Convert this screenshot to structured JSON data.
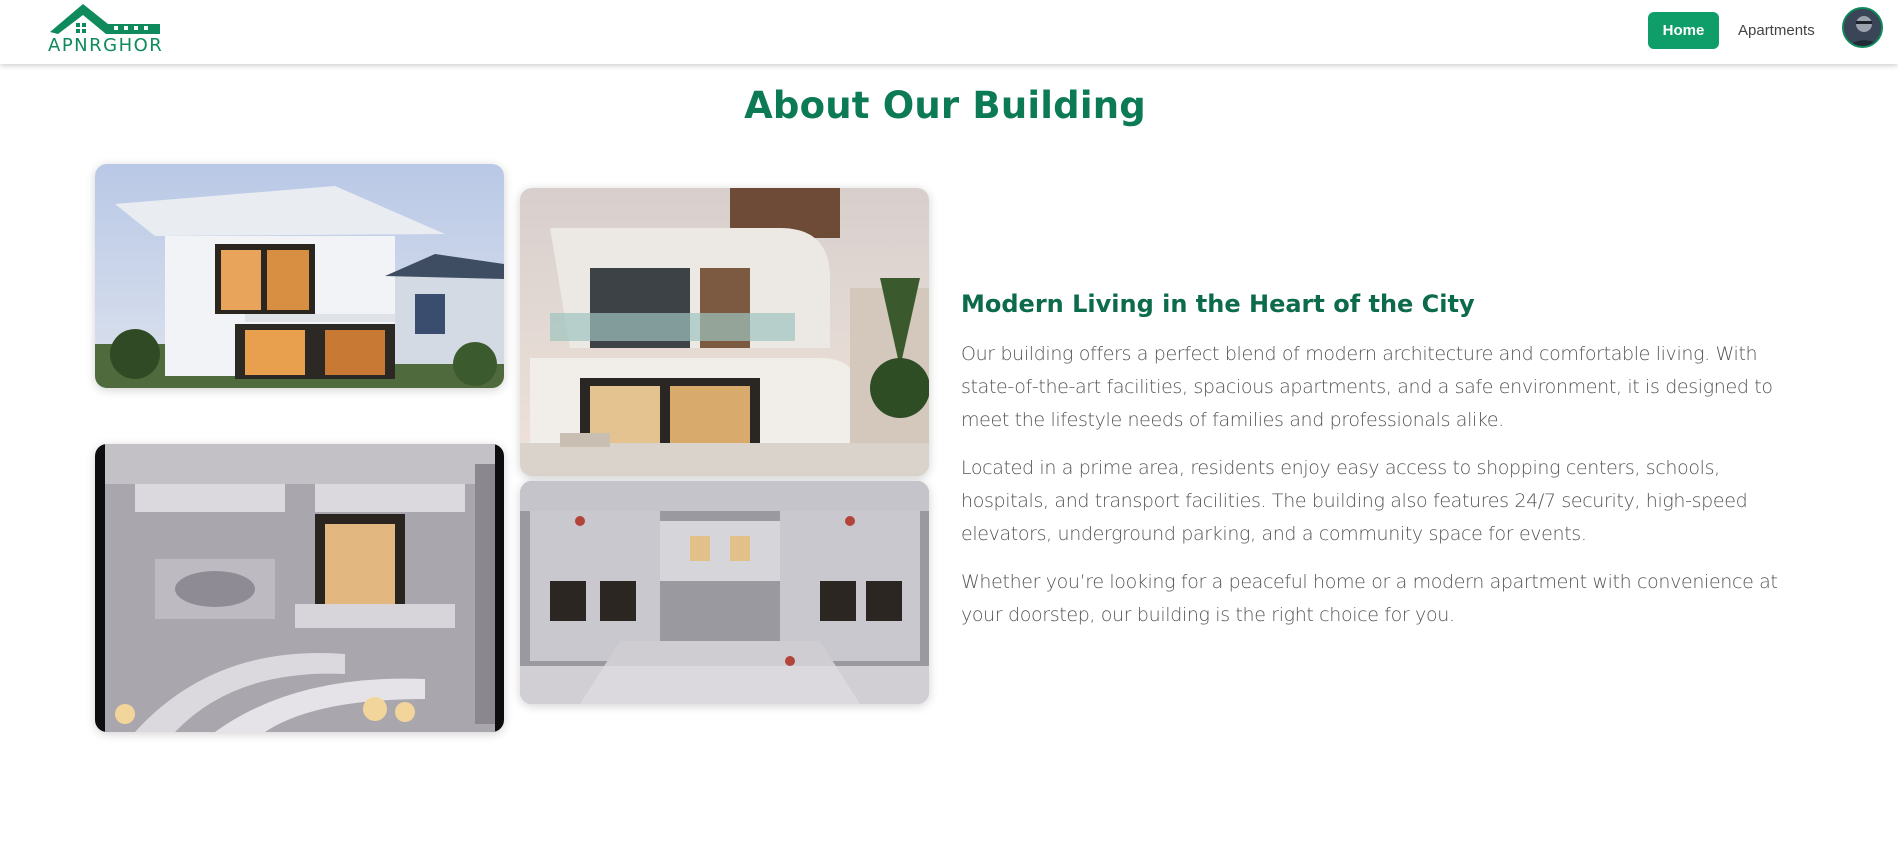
{
  "nav": {
    "brand": "APNRGHOR",
    "home_label": "Home",
    "apartments_label": "Apartments"
  },
  "about": {
    "title": "About Our Building",
    "subtitle": "Modern Living in the Heart of the City",
    "paragraphs": [
      "Our building offers a perfect blend of modern architecture and comfortable living. With state-of-the-art facilities, spacious apartments, and a safe environment, it is designed to meet the lifestyle needs of families and professionals alike.",
      "Located in a prime area, residents enjoy easy access to shopping centers, schools, hospitals, and transport facilities. The building also features 24/7 security, high-speed elevators, underground parking, and a community space for events.",
      "Whether you’re looking for a peaceful home or a modern apartment with convenience at your doorstep, our building is the right choice for you."
    ]
  },
  "colors": {
    "brand_green": "#0e8a5c",
    "button_green": "#0f9d6a",
    "title_green": "#0b7a55"
  },
  "icons": {
    "logo": "house-roof-logo",
    "avatar": "user-avatar"
  }
}
